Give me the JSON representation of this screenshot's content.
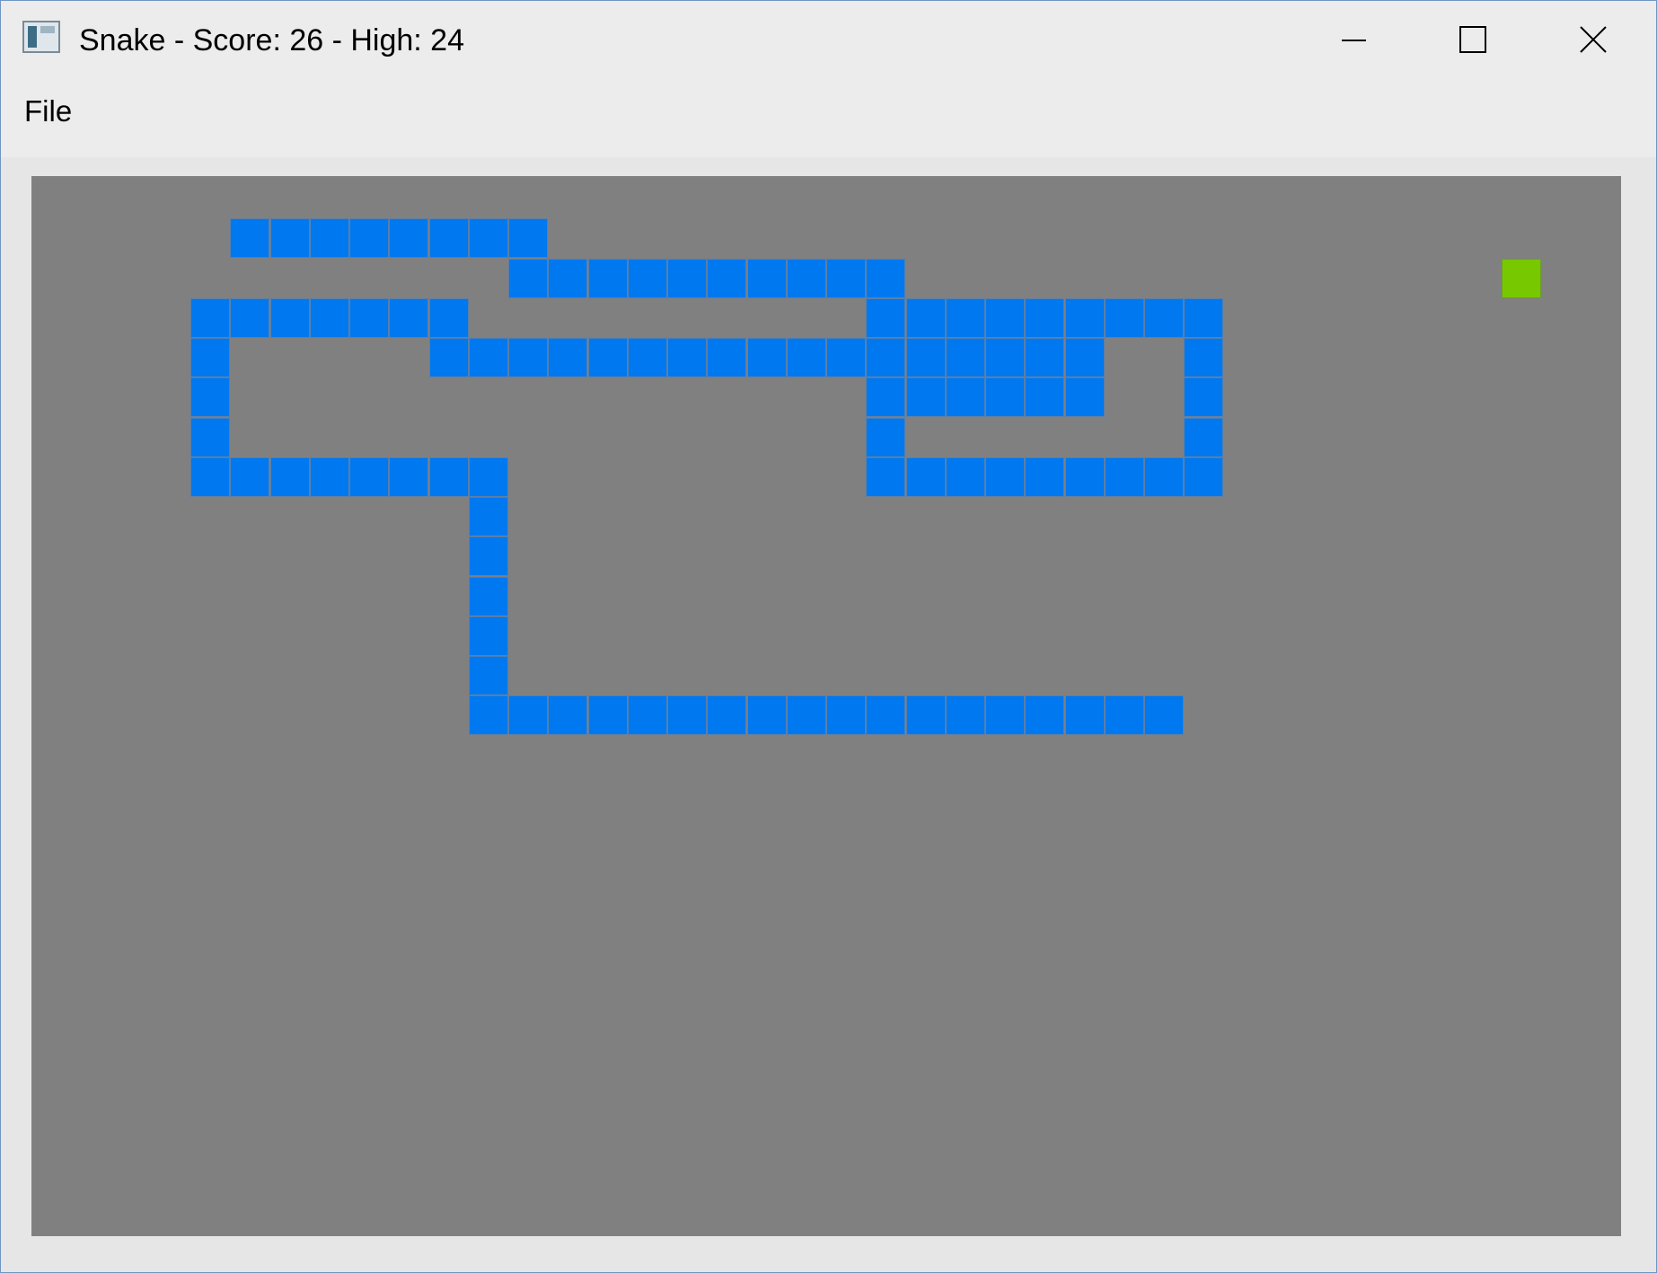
{
  "window": {
    "title": "Snake - Score: 26 - High: 24",
    "icon": "app-window-icon",
    "controls": {
      "minimize": "minimize-icon",
      "maximize": "maximize-icon",
      "close": "close-icon"
    }
  },
  "menu": {
    "file_label": "File"
  },
  "game": {
    "grid": {
      "cols": 40,
      "rows": 25
    },
    "colors": {
      "background": "#808080",
      "snake": "#0078f0",
      "food": "#78c800"
    },
    "food": [
      37,
      2
    ],
    "snake_cells": [
      [
        5,
        1
      ],
      [
        6,
        1
      ],
      [
        7,
        1
      ],
      [
        8,
        1
      ],
      [
        9,
        1
      ],
      [
        10,
        1
      ],
      [
        11,
        1
      ],
      [
        12,
        1
      ],
      [
        12,
        2
      ],
      [
        13,
        2
      ],
      [
        14,
        2
      ],
      [
        15,
        2
      ],
      [
        16,
        2
      ],
      [
        17,
        2
      ],
      [
        18,
        2
      ],
      [
        19,
        2
      ],
      [
        20,
        2
      ],
      [
        21,
        2
      ],
      [
        4,
        3
      ],
      [
        5,
        3
      ],
      [
        6,
        3
      ],
      [
        7,
        3
      ],
      [
        8,
        3
      ],
      [
        9,
        3
      ],
      [
        10,
        3
      ],
      [
        21,
        3
      ],
      [
        22,
        3
      ],
      [
        23,
        3
      ],
      [
        24,
        3
      ],
      [
        25,
        3
      ],
      [
        26,
        3
      ],
      [
        27,
        3
      ],
      [
        28,
        3
      ],
      [
        29,
        3
      ],
      [
        4,
        4
      ],
      [
        10,
        4
      ],
      [
        11,
        4
      ],
      [
        12,
        4
      ],
      [
        13,
        4
      ],
      [
        14,
        4
      ],
      [
        15,
        4
      ],
      [
        16,
        4
      ],
      [
        17,
        4
      ],
      [
        18,
        4
      ],
      [
        19,
        4
      ],
      [
        20,
        4
      ],
      [
        21,
        4
      ],
      [
        22,
        4
      ],
      [
        23,
        4
      ],
      [
        24,
        4
      ],
      [
        25,
        4
      ],
      [
        26,
        4
      ],
      [
        29,
        4
      ],
      [
        4,
        5
      ],
      [
        21,
        5
      ],
      [
        22,
        5
      ],
      [
        23,
        5
      ],
      [
        24,
        5
      ],
      [
        25,
        5
      ],
      [
        26,
        5
      ],
      [
        29,
        5
      ],
      [
        4,
        6
      ],
      [
        21,
        6
      ],
      [
        29,
        6
      ],
      [
        4,
        7
      ],
      [
        5,
        7
      ],
      [
        6,
        7
      ],
      [
        7,
        7
      ],
      [
        8,
        7
      ],
      [
        9,
        7
      ],
      [
        10,
        7
      ],
      [
        11,
        7
      ],
      [
        21,
        7
      ],
      [
        22,
        7
      ],
      [
        23,
        7
      ],
      [
        24,
        7
      ],
      [
        25,
        7
      ],
      [
        26,
        7
      ],
      [
        27,
        7
      ],
      [
        28,
        7
      ],
      [
        29,
        7
      ],
      [
        11,
        8
      ],
      [
        11,
        9
      ],
      [
        11,
        10
      ],
      [
        11,
        11
      ],
      [
        11,
        12
      ],
      [
        11,
        13
      ],
      [
        12,
        13
      ],
      [
        13,
        13
      ],
      [
        14,
        13
      ],
      [
        15,
        13
      ],
      [
        16,
        13
      ],
      [
        17,
        13
      ],
      [
        18,
        13
      ],
      [
        19,
        13
      ],
      [
        20,
        13
      ],
      [
        21,
        13
      ],
      [
        22,
        13
      ],
      [
        23,
        13
      ],
      [
        24,
        13
      ],
      [
        25,
        13
      ],
      [
        26,
        13
      ],
      [
        27,
        13
      ],
      [
        28,
        13
      ]
    ]
  }
}
